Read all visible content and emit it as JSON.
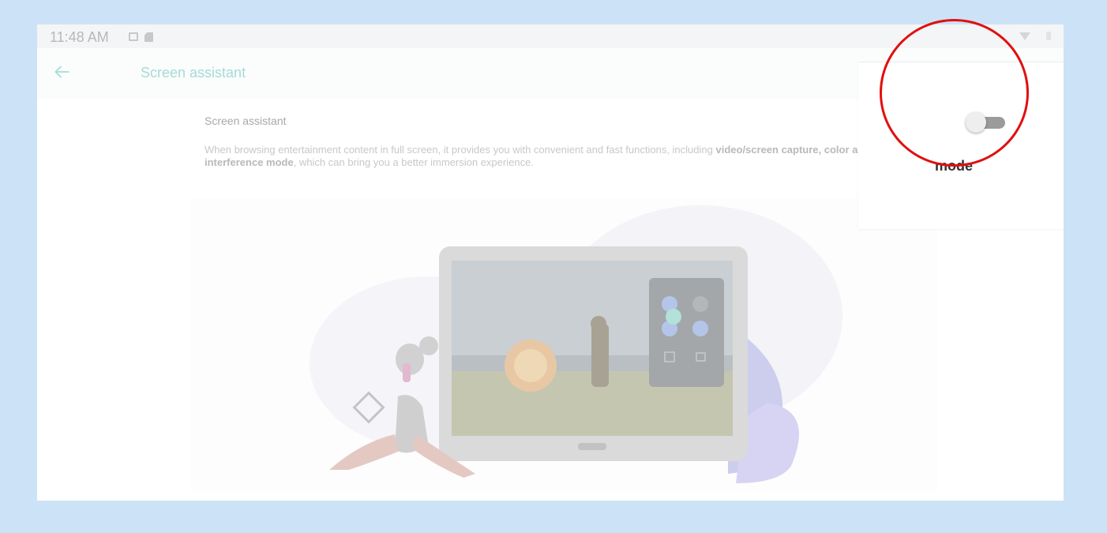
{
  "status_bar": {
    "time": "11:48 AM",
    "icons": [
      "image-icon",
      "sd-card-icon",
      "wifi-icon",
      "battery-icon"
    ]
  },
  "toolbar": {
    "title": "Screen assistant",
    "back_icon": "arrow-left-icon",
    "search_icon": "search-icon"
  },
  "content": {
    "heading": "Screen assistant",
    "description_parts": [
      "When browsing entertainment content in full screen, it provides you with convenient and fast functions, including ",
      "video/screen capture, color",
      " ",
      "and non-interference mode",
      ", which can bring you a better immersion experience."
    ]
  },
  "popup": {
    "label": "mode",
    "toggle_on": false
  },
  "colors": {
    "accent": "#a5dcd6",
    "background": "#cce2f7",
    "annotation": "#e01010"
  }
}
